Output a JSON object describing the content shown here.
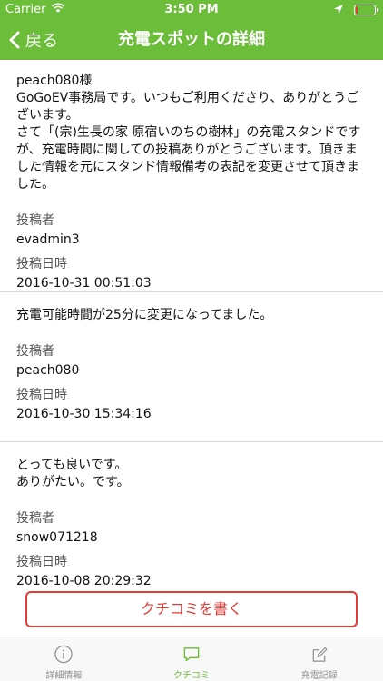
{
  "status_bar": {
    "carrier": "Carrier",
    "time": "3:50 PM",
    "battery_level": 0.1,
    "battery_color": "#e53935"
  },
  "nav": {
    "back_label": "戻る",
    "title": "充電スポットの詳細",
    "color": "#6cbd3a"
  },
  "posts": [
    {
      "body": "peach080様\nGoGoEV事務局です。いつもご利用くださり、ありがとうございます。\nさて「(宗)生長の家 原宿いのちの樹林」の充電スタンドですが、充電時間に関しての投稿ありがとうございます。頂きました情報を元にスタンド情報備考の表記を変更させて頂きました。",
      "poster_label": "投稿者",
      "poster": "evadmin3",
      "date_label": "投稿日時",
      "date": "2016-10-31 00:51:03"
    },
    {
      "body": "充電可能時間が25分に変更になってました。",
      "poster_label": "投稿者",
      "poster": "peach080",
      "date_label": "投稿日時",
      "date": "2016-10-30 15:34:16"
    },
    {
      "body": "とっても良いです。\nありがたい。です。",
      "poster_label": "投稿者",
      "poster": "snow071218",
      "date_label": "投稿日時",
      "date": "2016-10-08 20:29:32"
    }
  ],
  "write_button": {
    "label": "クチコミを書く",
    "color": "#e53935"
  },
  "tabs": [
    {
      "label": "詳細情報",
      "icon": "info-icon"
    },
    {
      "label": "クチコミ",
      "icon": "speech-bubble-icon",
      "active": true
    },
    {
      "label": "充電記録",
      "icon": "compose-icon"
    }
  ]
}
